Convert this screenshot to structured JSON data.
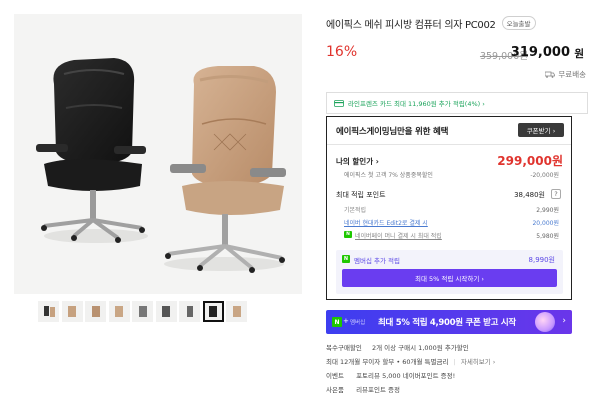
{
  "product": {
    "title": "에이픽스 메쉬 피시방 컴퓨터 의자 PC002",
    "badge": "오늘출발",
    "discount_rate": "16%",
    "original_price": "359,000원",
    "sale_price": "319,000",
    "sale_unit": "원",
    "shipping": "무료배송"
  },
  "card_banner": "라인프렌즈 카드 최대 11,960원 추가 적립(4%) ›",
  "benefits": {
    "title": "에이픽스게이밍님만을 위한 혜택",
    "coupon_button": "쿠폰받기 ›",
    "my_price_label": "나의 할인가 ›",
    "my_price_value": "299,000원",
    "member_note": "에이픽스 첫 고객 7% 상품중복할인",
    "member_discount": "-20,000원",
    "points_label": "최대 적립 포인트",
    "points_value": "38,480원",
    "points_help": "?",
    "point_rows": [
      {
        "label": "기본적립",
        "value": "2,990원"
      },
      {
        "label": "네이버 현대카드 Edit2로 결제 시",
        "value": "20,000원"
      },
      {
        "label": "네이버페이 머니 결제 시 최대 적립",
        "value": "5,980원"
      }
    ],
    "naverpay_icon": "N",
    "membership_label": "멤버십 추가 적립",
    "membership_value": "8,990원",
    "membership_button": "최대 5% 적립 시작하기 ›"
  },
  "promo": {
    "n": "N",
    "plus": "+",
    "membership": "멤버십",
    "text": "최대 5% 적립 4,900원 쿠폰 받고 시작",
    "arrow": "›"
  },
  "info_lines": [
    {
      "key": "복수구매할인",
      "value": "2개 이상 구매시 1,000원 추가할인"
    },
    {
      "key": "최대 12개월 무이자 할부 • 60개월 특별금리",
      "value": "",
      "more": "자세히보기 ›"
    },
    {
      "key": "이벤트",
      "value": "포토리뷰 5,000 네이버포인트 증정!"
    },
    {
      "key": "사은품",
      "value": "리뷰포인트 증정"
    }
  ],
  "icons": {
    "shipping": "truck-icon",
    "card": "card-icon"
  },
  "colors": {
    "discount": "#e0342e",
    "accent": "#6a3df0",
    "naver_green": "#1ec800",
    "card_green": "#1aa35a"
  }
}
